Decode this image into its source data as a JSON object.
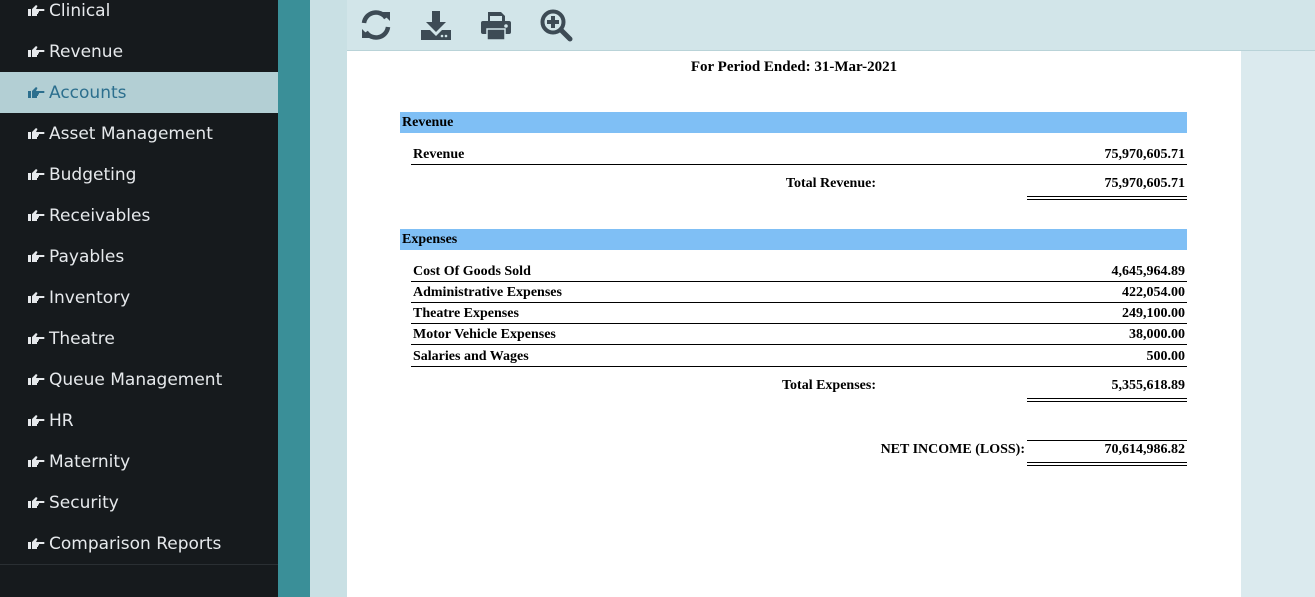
{
  "sidebar": {
    "items": [
      {
        "label": "Clinical"
      },
      {
        "label": "Revenue"
      },
      {
        "label": "Accounts",
        "active": true
      },
      {
        "label": "Asset Management"
      },
      {
        "label": "Budgeting"
      },
      {
        "label": "Receivables"
      },
      {
        "label": "Payables"
      },
      {
        "label": "Inventory"
      },
      {
        "label": "Theatre"
      },
      {
        "label": "Queue Management"
      },
      {
        "label": "HR"
      },
      {
        "label": "Maternity"
      },
      {
        "label": "Security"
      },
      {
        "label": "Comparison Reports"
      }
    ],
    "item_icon": "hand-pointing-right-icon"
  },
  "toolbar": {
    "buttons": [
      {
        "icon": "refresh-icon"
      },
      {
        "icon": "download-icon"
      },
      {
        "icon": "print-icon"
      },
      {
        "icon": "zoom-in-icon"
      }
    ],
    "icon_color": "#3d4b55"
  },
  "report": {
    "period": "For Period Ended: 31-Mar-2021",
    "revenue": {
      "header": "Revenue",
      "rows": [
        {
          "label": "Revenue",
          "amount": "75,970,605.71"
        }
      ],
      "total_label": "Total Revenue:",
      "total_amount": "75,970,605.71"
    },
    "expenses": {
      "header": "Expenses",
      "rows": [
        {
          "label": "Cost Of Goods Sold",
          "amount": "4,645,964.89"
        },
        {
          "label": "Administrative Expenses",
          "amount": "422,054.00"
        },
        {
          "label": "Theatre Expenses",
          "amount": "249,100.00"
        },
        {
          "label": "Motor Vehicle Expenses",
          "amount": "38,000.00"
        },
        {
          "label": "Salaries and Wages",
          "amount": "500.00"
        }
      ],
      "total_label": "Total Expenses:",
      "total_amount": "5,355,618.89"
    },
    "net_label": "NET INCOME (LOSS):",
    "net_amount": "70,614,986.82"
  },
  "colors": {
    "sidebar_bg": "#161a1d",
    "active_bg": "#b3cfd4",
    "section_header_bg": "#7fbff5",
    "teal_strip": "#3a8f98"
  }
}
